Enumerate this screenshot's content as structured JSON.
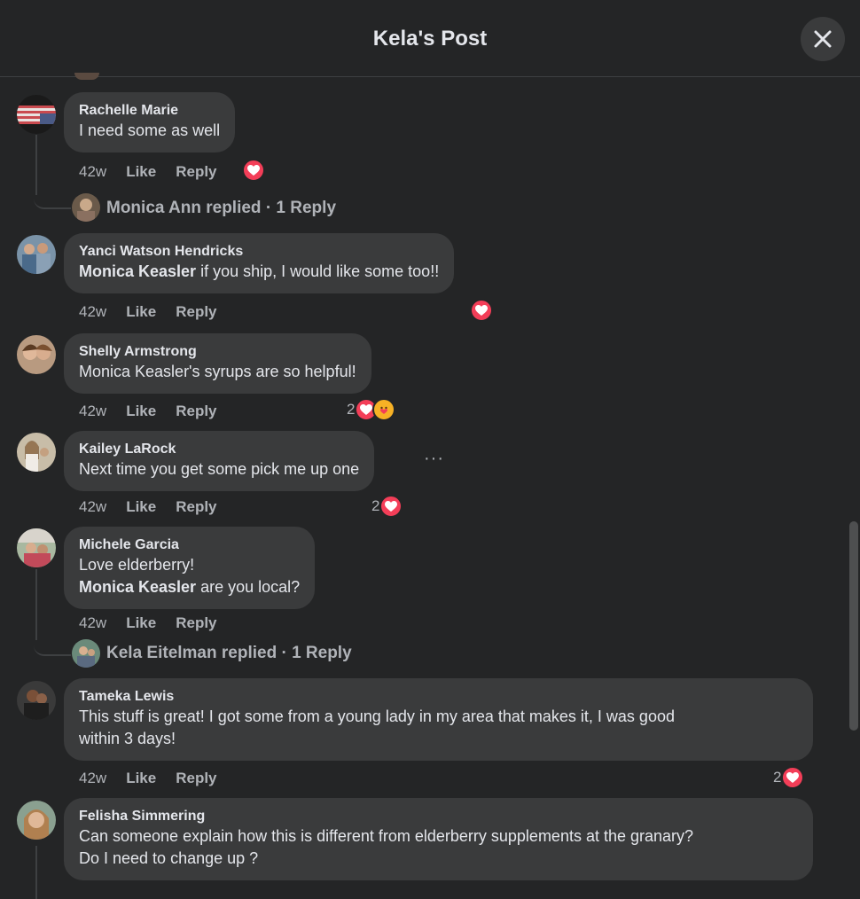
{
  "header": {
    "title": "Kela's Post"
  },
  "actions": {
    "like": "Like",
    "reply": "Reply"
  },
  "comments": [
    {
      "name": "Rachelle Marie",
      "text": "I need some as well",
      "time": "42w",
      "reaction_count": "",
      "replied": "Monica Ann replied · 1 Reply"
    },
    {
      "name": "Yanci Watson Hendricks",
      "mention": "Monica Keasler",
      "text": " if you ship, I would like some too!!",
      "time": "42w",
      "reaction_count": ""
    },
    {
      "name": "Shelly Armstrong",
      "text": "Monica Keasler's syrups are so helpful!",
      "time": "42w",
      "reaction_count": "2"
    },
    {
      "name": "Kailey LaRock",
      "text": "Next time you get some pick me up one",
      "time": "42w",
      "reaction_count": "2",
      "more": "···"
    },
    {
      "name": "Michele Garcia",
      "text": "Love elderberry!",
      "mention": "Monica Keasler",
      "text2": " are you local?",
      "time": "42w",
      "reaction_count": "",
      "replied": "Kela Eitelman replied · 1 Reply"
    },
    {
      "name": "Tameka Lewis",
      "text": "This stuff is great! I got some from a young lady in my area that makes it, I was good",
      "text2": "within 3 days!",
      "time": "42w",
      "reaction_count": "2"
    },
    {
      "name": "Felisha Simmering",
      "text": "Can someone explain how this is different from elderberry supplements at the granary?",
      "text2": "Do I need to change up ?"
    }
  ],
  "colors": {
    "background": "#242526",
    "bubble": "#3a3b3c",
    "love": "#f33e58",
    "care": "#f7b125",
    "secondary_text": "#b0b3b8"
  },
  "icons": {
    "close": "close-icon",
    "love": "heart-icon",
    "care": "care-icon",
    "more": "more-dots-icon"
  }
}
